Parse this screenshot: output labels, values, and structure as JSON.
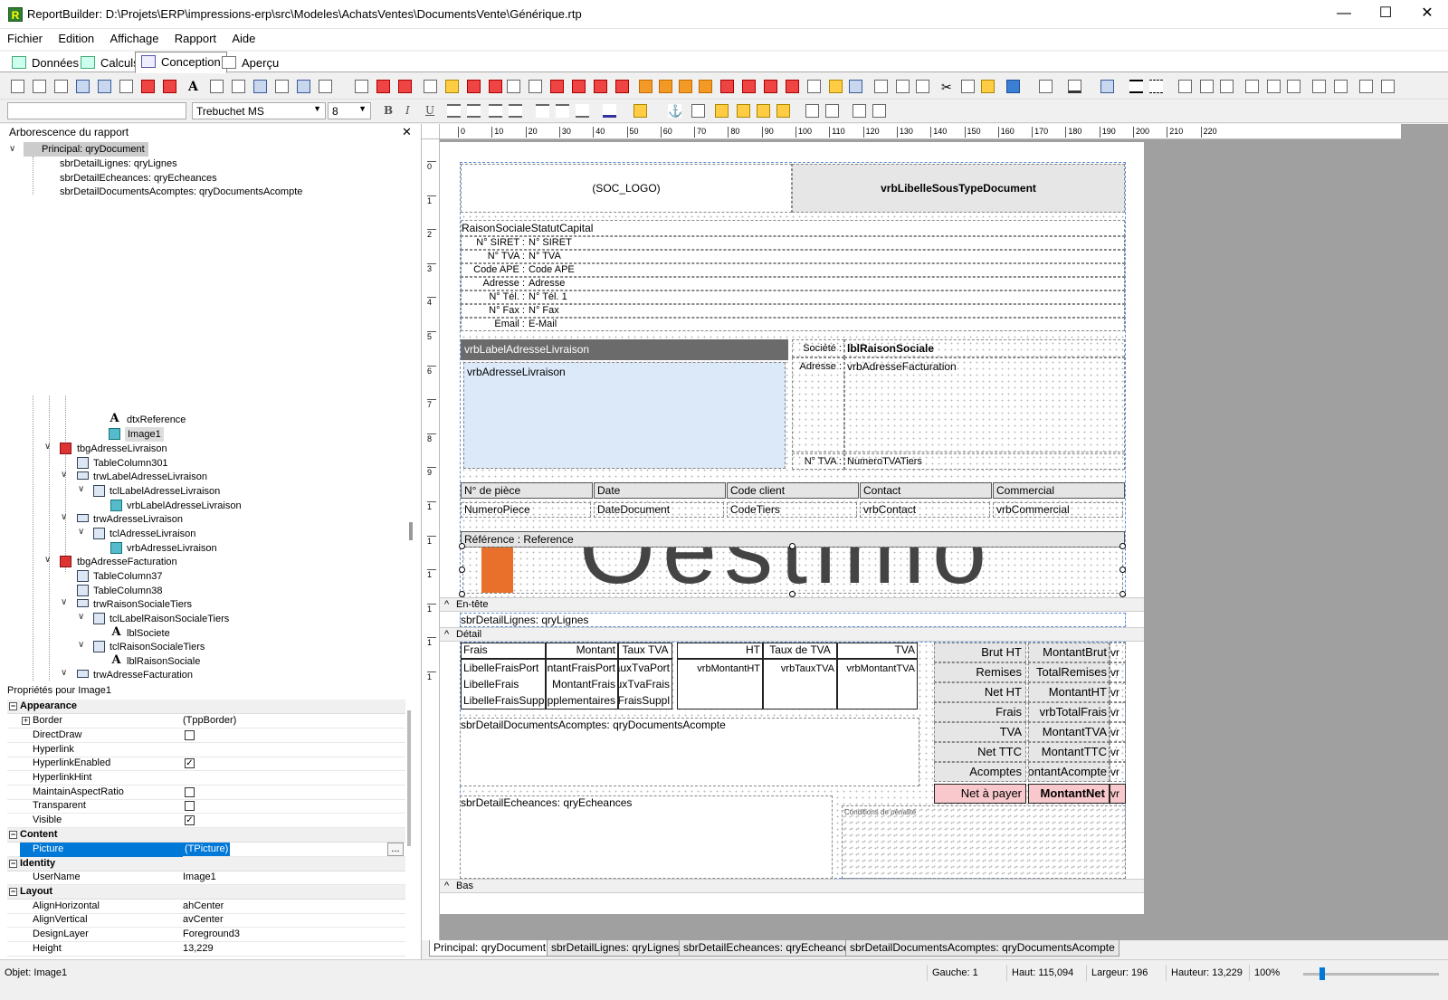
{
  "window": {
    "title": "ReportBuilder: D:\\Projets\\ERP\\impressions-erp\\src\\Modeles\\AchatsVentes\\DocumentsVente\\Générique.rtp",
    "app_icon": "R",
    "minimize": "—",
    "maximize": "☐",
    "close": "✕"
  },
  "menu": [
    "Fichier",
    "Edition",
    "Affichage",
    "Rapport",
    "Aide"
  ],
  "tabs": [
    {
      "label": "Données"
    },
    {
      "label": "Calculs"
    },
    {
      "label": "Conception"
    },
    {
      "label": "Aperçu"
    }
  ],
  "format_bar": {
    "font_name": "Trebuchet MS",
    "font_size": "8",
    "bold": "B",
    "italic": "I",
    "underline": "U"
  },
  "tree_panel": {
    "title": "Arborescence du rapport",
    "close": "✕",
    "top_items": [
      "Principal: qryDocument",
      "sbrDetailLignes: qryLignes",
      "sbrDetailEcheances: qryEcheances",
      "sbrDetailDocumentsAcomptes: qryDocumentsAcompte"
    ],
    "items": [
      "dtxReference",
      "Image1",
      "tbgAdresseLivraison",
      "TableColumn301",
      "trwLabelAdresseLivraison",
      "tclLabelAdresseLivraison",
      "vrbLabelAdresseLivraison",
      "trwAdresseLivraison",
      "tclAdresseLivraison",
      "vrbAdresseLivraison",
      "tbgAdresseFacturation",
      "TableColumn37",
      "TableColumn38",
      "trwRaisonSocialeTiers",
      "tclLabelRaisonSocialeTiers",
      "lblSociete",
      "tclRaisonSocialeTiers",
      "lblRaisonSociale",
      "trwAdresseFacturation"
    ]
  },
  "properties": {
    "title": "Propriétés pour Image1",
    "categories": {
      "appearance": "Appearance",
      "content": "Content",
      "identity": "Identity",
      "layout": "Layout"
    },
    "rows": {
      "border": {
        "name": "Border",
        "value": "(TppBorder)"
      },
      "directdraw": {
        "name": "DirectDraw",
        "checked": false
      },
      "hyperlink": {
        "name": "Hyperlink",
        "value": ""
      },
      "hyperlinkenabled": {
        "name": "HyperlinkEnabled",
        "checked": true
      },
      "hyperlinkhint": {
        "name": "HyperlinkHint",
        "value": ""
      },
      "maintainaspect": {
        "name": "MaintainAspectRatio",
        "checked": false
      },
      "transparent": {
        "name": "Transparent",
        "checked": false
      },
      "visible": {
        "name": "Visible",
        "checked": true
      },
      "picture": {
        "name": "Picture",
        "value": "(TPicture)"
      },
      "username": {
        "name": "UserName",
        "value": "Image1"
      },
      "alignh": {
        "name": "AlignHorizontal",
        "value": "ahCenter"
      },
      "alignv": {
        "name": "AlignVertical",
        "value": "avCenter"
      },
      "designlayer": {
        "name": "DesignLayer",
        "value": "Foreground3"
      },
      "height": {
        "name": "Height",
        "value": "13,229"
      }
    },
    "check_mark": "✓",
    "ellipsis": "..."
  },
  "ruler": {
    "h_ticks": [
      "0",
      "10",
      "20",
      "30",
      "40",
      "50",
      "60",
      "70",
      "80",
      "90",
      "100",
      "110",
      "120",
      "130",
      "140",
      "150",
      "160",
      "170",
      "180",
      "190",
      "200",
      "210",
      "220"
    ],
    "v_ticks": [
      "0",
      "1",
      "2",
      "3",
      "4",
      "5",
      "6",
      "7",
      "8",
      "9",
      "1",
      "1",
      "1",
      "1",
      "1",
      "1"
    ]
  },
  "report": {
    "soc_logo": "(SOC_LOGO)",
    "sous_type": "vrbLibelleSousTypeDocument",
    "raison_sociale": "RaisonSocialeStatutCapital",
    "company_lines": [
      {
        "label": "N° SIRET :",
        "value": "N° SIRET"
      },
      {
        "label": "N° TVA :",
        "value": "N° TVA"
      },
      {
        "label": "Code APE :",
        "value": "Code APE"
      },
      {
        "label": "Adresse :",
        "value": "Adresse"
      },
      {
        "label": "N° Tél. :",
        "value": "N° Tél. 1"
      },
      {
        "label": "N° Fax :",
        "value": "N° Fax"
      },
      {
        "label": "Email :",
        "value": "E-Mail"
      }
    ],
    "label_adr_livraison": "vrbLabelAdresseLivraison",
    "adr_livraison": "vrbAdresseLivraison",
    "societe_label": "Société :",
    "societe_value": "lblRaisonSociale",
    "adresse_label": "Adresse :",
    "adresse_value": "vrbAdresseFacturation",
    "tva_label": "N° TVA :",
    "tva_value": "NumeroTVATiers",
    "header_cells": [
      "N° de pièce",
      "Date",
      "Code client",
      "Contact",
      "Commercial"
    ],
    "value_cells": [
      "NumeroPiece",
      "DateDocument",
      "CodeTiers",
      "vrbContact",
      "vrbCommercial"
    ],
    "reference": "Référence : Reference",
    "image_text": "Oestimo",
    "band_entete": "En-tête",
    "sub_lignes": "sbrDetailLignes: qryLignes",
    "band_detail": "Détail",
    "frais_headers": [
      "Frais",
      "Montant",
      "Taux TVA"
    ],
    "frais_rows": [
      [
        "LibelleFraisPort",
        "MontantFraisPort",
        "TauxTvaPort"
      ],
      [
        "LibelleFrais",
        "MontantFrais",
        "TauxTvaFrais"
      ],
      [
        "LibelleFraisSuppl",
        "MontantFraisSupplementaires",
        "TauxTvaFraisSuppl"
      ]
    ],
    "tva_headers": [
      "HT",
      "Taux de TVA",
      "TVA"
    ],
    "tva_values": [
      "vrbMontantHT",
      "vrbTauxTVA",
      "vrbMontantTVA"
    ],
    "totals": [
      {
        "label": "Brut HT",
        "value": "MontantBrut",
        "extra": "vr"
      },
      {
        "label": "Remises",
        "value": "TotalRemises",
        "extra": "vr"
      },
      {
        "label": "Net HT",
        "value": "MontantHT",
        "extra": "vr"
      },
      {
        "label": "Frais",
        "value": "vrbTotalFrais",
        "extra": "vr"
      },
      {
        "label": "TVA",
        "value": "MontantTVA",
        "extra": "vr"
      },
      {
        "label": "Net TTC",
        "value": "MontantTTC",
        "extra": "vr"
      },
      {
        "label": "Acomptes",
        "value": "MontantAcompte",
        "extra": "vr"
      }
    ],
    "net_a_payer": {
      "label": "Net à payer",
      "value": "MontantNet",
      "extra": "vr"
    },
    "sub_acomptes": "sbrDetailDocumentsAcomptes: qryDocumentsAcompte",
    "sub_echeances": "sbrDetailEcheances: qryEcheances",
    "conditions": "Conditions de pénalité",
    "band_bas": "Bas"
  },
  "bottom_tabs": [
    "Principal: qryDocument",
    "sbrDetailLignes: qryLignes",
    "sbrDetailEcheances: qryEcheances",
    "sbrDetailDocumentsAcomptes: qryDocumentsAcompte"
  ],
  "status": {
    "object": "Objet: Image1",
    "gauche": "Gauche: 1",
    "haut": "Haut: 115,094",
    "largeur": "Largeur: 196",
    "hauteur": "Hauteur: 13,229",
    "zoom": "100%",
    "zoom_level": 0.12
  },
  "colors": {
    "accent": "#0078d7",
    "selection": "#3b7fd4",
    "net_a_payer_bg": "#f9c8cc",
    "livraison_label_bg": "#6b6b6b",
    "livraison_body_bg": "#dbe9f9",
    "logo_orange": "#e8702a"
  }
}
